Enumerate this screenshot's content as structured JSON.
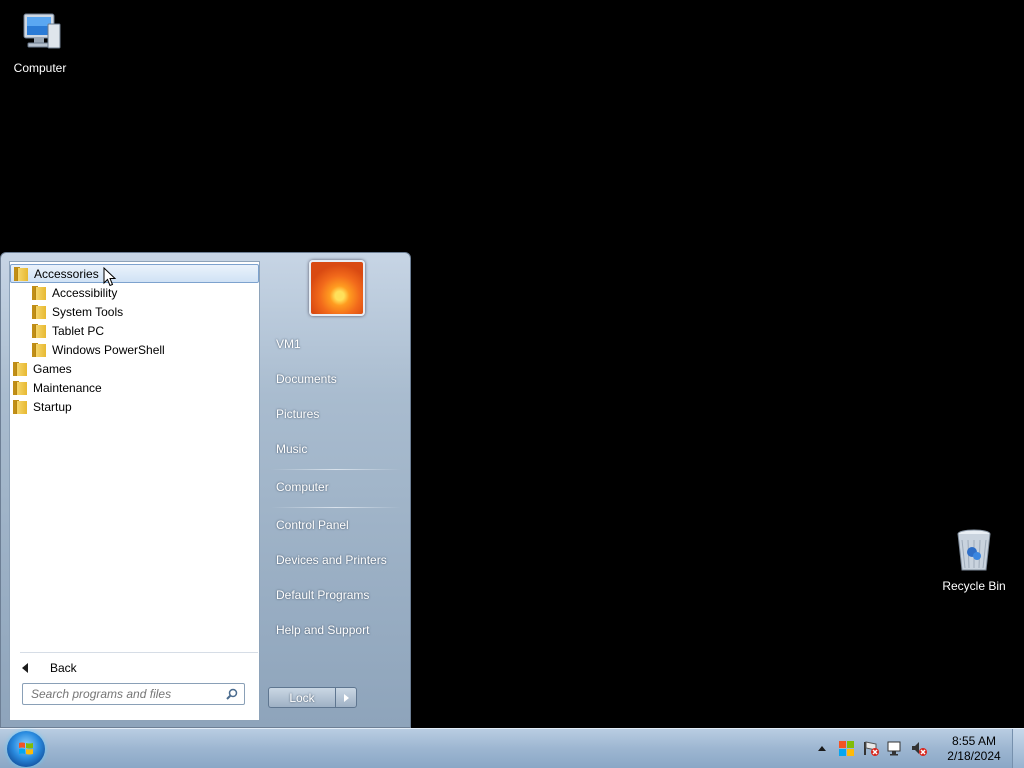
{
  "desktop": {
    "icons": [
      {
        "label": "Computer",
        "icon": "computer-icon"
      },
      {
        "label": "Recycle Bin",
        "icon": "recycle-bin-icon"
      }
    ]
  },
  "start_menu": {
    "programs": [
      {
        "label": "Accessories",
        "level": 0,
        "selected": true
      },
      {
        "label": "Accessibility",
        "level": 1
      },
      {
        "label": "System Tools",
        "level": 1
      },
      {
        "label": "Tablet PC",
        "level": 1
      },
      {
        "label": "Windows PowerShell",
        "level": 1
      },
      {
        "label": "Games",
        "level": 0
      },
      {
        "label": "Maintenance",
        "level": 0
      },
      {
        "label": "Startup",
        "level": 0
      }
    ],
    "back_label": "Back",
    "search_placeholder": "Search programs and files",
    "right_items": [
      {
        "label": "VM1"
      },
      {
        "label": "Documents"
      },
      {
        "label": "Pictures"
      },
      {
        "label": "Music"
      },
      {
        "label": "Computer"
      },
      {
        "label": "Control Panel"
      },
      {
        "label": "Devices and Printers"
      },
      {
        "label": "Default Programs"
      },
      {
        "label": "Help and Support"
      }
    ],
    "lock_label": "Lock"
  },
  "taskbar": {
    "time": "8:55 AM",
    "date": "2/18/2024",
    "tray_icons": [
      "action-center-icon",
      "network-disconnected-icon",
      "display-icon",
      "volume-muted-icon"
    ]
  }
}
